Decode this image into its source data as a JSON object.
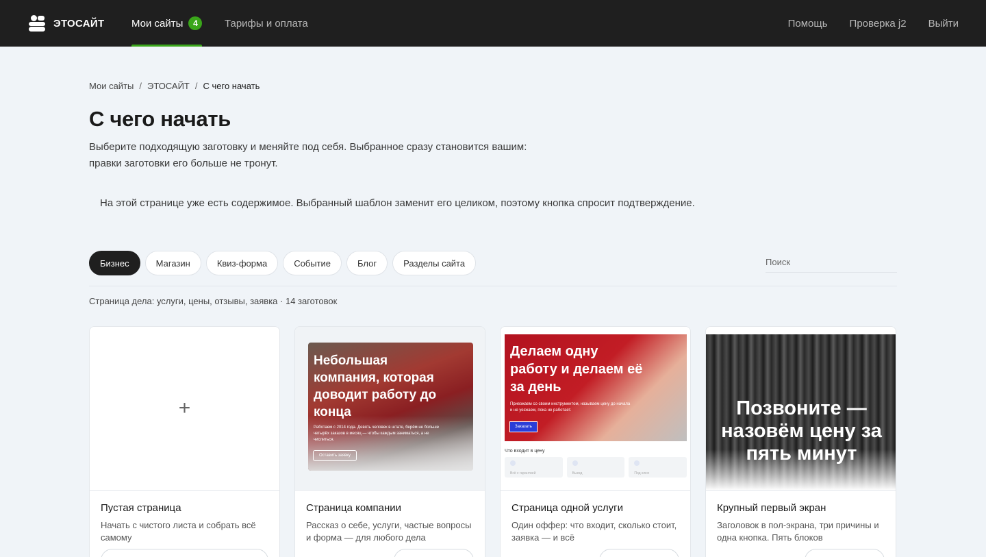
{
  "app": {
    "logo_text": "ЭТОСАЙТ",
    "logo_icon": "stacked-blocks-logo"
  },
  "nav": {
    "my_sites": "Мои сайты",
    "my_sites_count": "4",
    "tariffs": "Тарифы и оплата",
    "help": "Помощь",
    "user": "Проверка j2",
    "logout": "Выйти"
  },
  "breadcrumb": {
    "items": [
      "Мои сайты",
      "ЭТОСАЙТ",
      "С чего начать"
    ],
    "separator": "/"
  },
  "page": {
    "title": "С чего начать",
    "desc_line1": "Выберите подходящую заготовку и меняйте под себя. Выбранное сразу становится вашим:",
    "desc_line2": "правки заготовки его больше не тронут.",
    "notice": "На этой странице уже есть содержимое. Выбранный шаблон заменит его целиком, поэтому кнопка спросит подтверждение."
  },
  "filters": {
    "chips": [
      "Бизнес",
      "Магазин",
      "Квиз-форма",
      "Событие",
      "Блог",
      "Разделы сайта"
    ],
    "active_index": 0,
    "search_placeholder": "Поиск",
    "search_value": ""
  },
  "summary": "Страница дела: услуги, цены, отзывы, заявка · 14 заготовок",
  "cards": [
    {
      "title": "Пустая страница",
      "desc_line1": "Начать с чистого листа и собрать всё",
      "desc_line2": "самому",
      "plus": "+"
    },
    {
      "title": "Страница компании",
      "desc_line1": "Рассказ о себе, услуги, частые вопросы",
      "desc_line2": "и форма — для любого дела",
      "thumb_heading": "Небольшая компания, которая доводит работу до конца",
      "thumb_text": "Работаем с 2014 года. Девять человек в штате, берём не больше четырёх заказов в месяц — чтобы каждым заниматься, а не числиться.",
      "thumb_button": "Оставить заявку"
    },
    {
      "title": "Страница одной услуги",
      "desc_line1": "Один оффер: что входит, сколько стоит,",
      "desc_line2": "заявка — и всё",
      "thumb_heading": "Делаем одну работу и делаем её за день",
      "thumb_text": "Приезжаем со своим инструментом, называем цену до начала и не уезжаем, пока не работает.",
      "thumb_button": "Заказать",
      "thumb_section": "Что входит в цену",
      "thumb_features": [
        "Всё с гарантией",
        "Выезд",
        "Под ключ"
      ]
    },
    {
      "title": "Крупный первый экран",
      "desc_line1": "Заголовок в пол-экрана, три причины и",
      "desc_line2": "одна кнопка. Пять блоков",
      "thumb_heading": "Позвоните — назовём цену за пять минут"
    }
  ],
  "colors": {
    "topbar": "#1f1f1f",
    "accent_green": "#3aa61a",
    "page_bg": "#f0f4f8"
  }
}
